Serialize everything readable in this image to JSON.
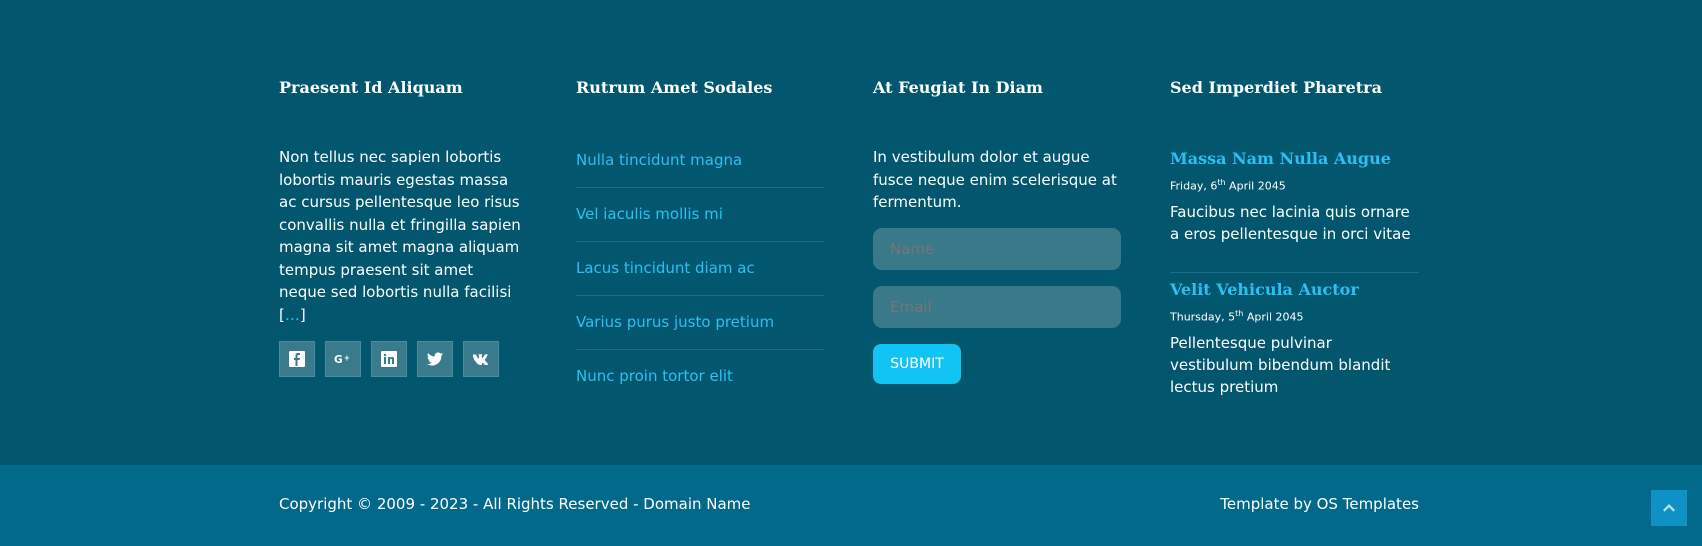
{
  "columns": {
    "about": {
      "heading": "Praesent Id Aliquam",
      "text": "Non tellus nec sapien lobortis lobortis mauris egestas massa ac cursus pellentesque leo risus convallis nulla et fringilla sapien magna sit amet magna aliquam tempus praesent sit amet neque sed lobortis nulla facilisi",
      "more_open": "[",
      "more_link": "…",
      "more_close": "]",
      "social": [
        "facebook-icon",
        "google-plus-icon",
        "linkedin-icon",
        "twitter-icon",
        "vk-icon"
      ]
    },
    "links": {
      "heading": "Rutrum Amet Sodales",
      "items": [
        "Nulla tincidunt magna",
        "Vel iaculis mollis mi",
        "Lacus tincidunt diam ac",
        "Varius purus justo pretium",
        "Nunc proin tortor elit"
      ]
    },
    "newsletter": {
      "heading": "At Feugiat In Diam",
      "text": "In vestibulum dolor et augue fusce neque enim scelerisque at fermentum.",
      "name_placeholder": "Name",
      "email_placeholder": "Email",
      "submit_label": "SUBMIT"
    },
    "posts": {
      "heading": "Sed Imperdiet Pharetra",
      "items": [
        {
          "title": "Massa Nam Nulla Augue",
          "date_prefix": "Friday, 6",
          "date_sup": "th",
          "date_suffix": " April 2045",
          "text": "Faucibus nec lacinia quis ornare a eros pellentesque in orci vitae"
        },
        {
          "title": "Velit Vehicula Auctor",
          "date_prefix": "Thursday, 5",
          "date_sup": "th",
          "date_suffix": " April 2045",
          "text": "Pellentesque pulvinar vestibulum bibendum blandit lectus pretium"
        }
      ]
    }
  },
  "bottom": {
    "copyright": "Copyright © 2009 - 2023 - All Rights Reserved - Domain Name",
    "credit": "Template by OS Templates",
    "back_to_top_icon": "chevron-up-icon"
  },
  "colors": {
    "footer_bg": "#02576e",
    "bottom_bg": "#02698a",
    "accent": "#29c0f2",
    "submit_bg": "#12c4f4"
  }
}
